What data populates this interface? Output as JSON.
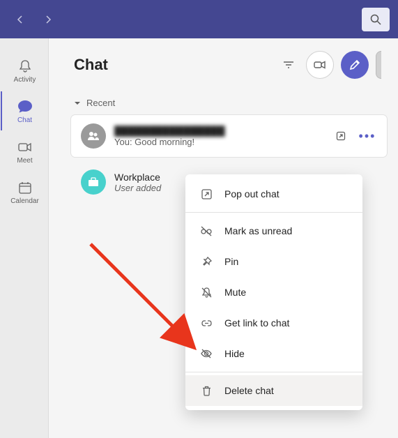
{
  "titlebar": {},
  "sidebar": {
    "items": [
      {
        "label": "Activity",
        "active": false
      },
      {
        "label": "Chat",
        "active": true
      },
      {
        "label": "Meet",
        "active": false
      },
      {
        "label": "Calendar",
        "active": false
      }
    ]
  },
  "header": {
    "title": "Chat"
  },
  "section": {
    "label": "Recent"
  },
  "chats": [
    {
      "title": "████████████████",
      "sub": "You: Good morning!",
      "selected": true,
      "showActions": true
    },
    {
      "title": "Workplace",
      "sub": "User added",
      "selected": false,
      "showActions": false
    }
  ],
  "menu": {
    "top": {
      "label": "Pop out chat"
    },
    "mid": [
      {
        "label": "Mark as unread"
      },
      {
        "label": "Pin"
      },
      {
        "label": "Mute"
      },
      {
        "label": "Get link to chat"
      },
      {
        "label": "Hide"
      }
    ],
    "bot": {
      "label": "Delete chat"
    }
  }
}
